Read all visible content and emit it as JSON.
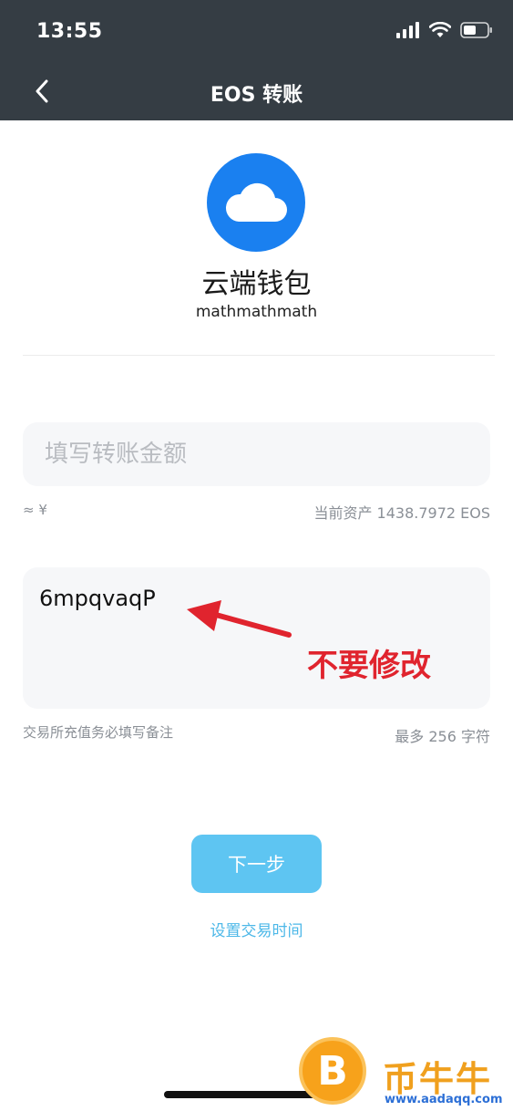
{
  "status_bar": {
    "time": "13:55"
  },
  "nav": {
    "title": "EOS 转账"
  },
  "wallet": {
    "name": "云端钱包",
    "account": "mathmathmath",
    "avatar_color": "#1a80f0"
  },
  "amount": {
    "placeholder": "填写转账金额",
    "fiat_approx": "≈ ¥",
    "balance": "当前资产 1438.7972 EOS"
  },
  "memo": {
    "value": "6mpqvaqP",
    "hint": "交易所充值务必填写备注",
    "limit": "最多 256 字符"
  },
  "annotation": {
    "text": "不要修改",
    "color": "#e0242e"
  },
  "actions": {
    "next_label": "下一步",
    "set_time_label": "设置交易时间",
    "accent_color": "#5ec5f2"
  },
  "watermark": {
    "coin_symbol": "B",
    "brand": "币牛牛",
    "url": "www.aadaqq.com"
  }
}
